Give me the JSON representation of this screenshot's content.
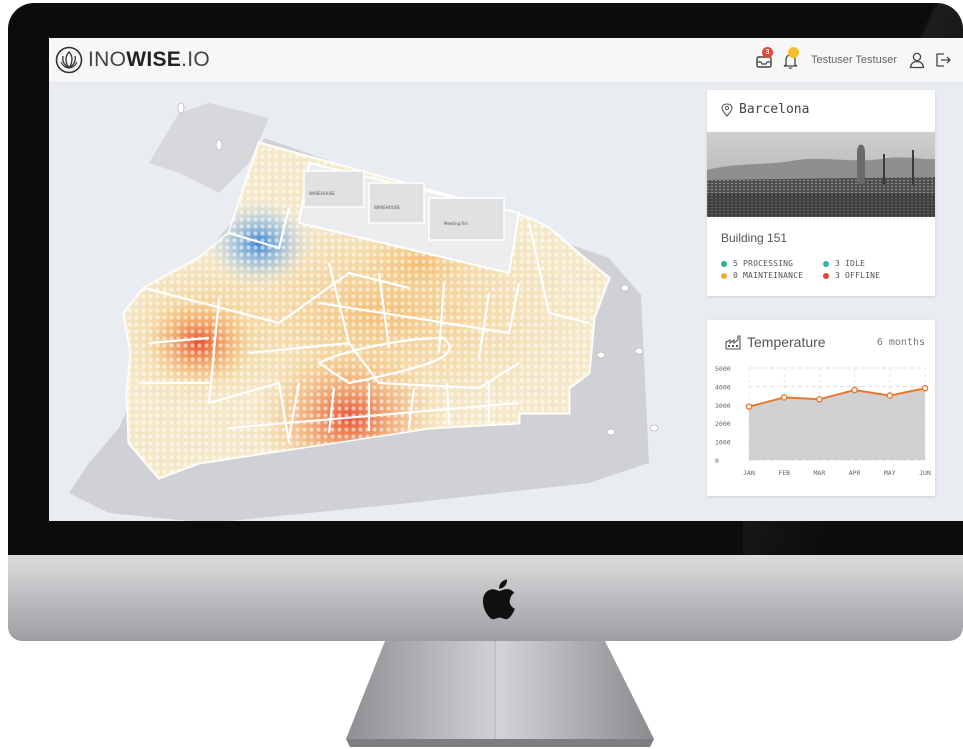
{
  "header": {
    "brand_prefix": "INO",
    "brand_bold": "WISE",
    "brand_suffix": ".IO",
    "messages_badge": "3",
    "user_name": "Testuser Testuser"
  },
  "location": {
    "city": "Barcelona",
    "building": "Building 151",
    "statuses": [
      {
        "label": "5 PROCESSING",
        "color": "#27b583"
      },
      {
        "label": "3 IDLE",
        "color": "#2ab3b3"
      },
      {
        "label": "0 MAINTEINANCE",
        "color": "#f2a93b"
      },
      {
        "label": "3 OFFLINE",
        "color": "#e0463a"
      }
    ]
  },
  "temperature": {
    "title": "Temperature",
    "range": "6 months"
  },
  "floorplan": {
    "room_labels": [
      "WAREHOUSE",
      "WAREHOUSE",
      "Meeting Rm"
    ]
  },
  "colors": {
    "line": "#e87a30",
    "area": "#c9c9c9",
    "heat_hot": "#e8482c",
    "heat_warm": "#f3c06a",
    "heat_cold": "#3f8ddb"
  },
  "chart_data": {
    "type": "area",
    "categories": [
      "JAN",
      "FEB",
      "MAR",
      "APR",
      "MAY",
      "JUN"
    ],
    "series": [
      {
        "values": [
          2900,
          3400,
          3300,
          3800,
          3500,
          3900
        ]
      }
    ],
    "yticks": [
      "5000",
      "4000",
      "3000",
      "2000",
      "1000",
      "0"
    ],
    "ylim": [
      0,
      5000
    ],
    "grid": true
  }
}
